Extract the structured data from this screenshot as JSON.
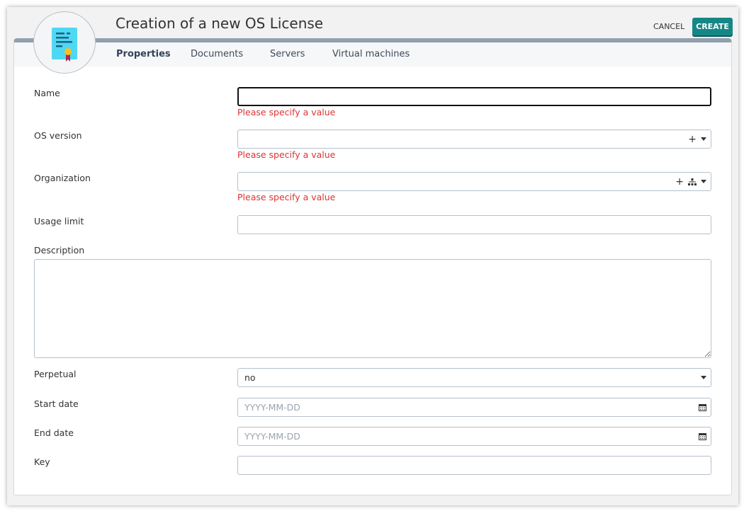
{
  "header": {
    "title": "Creation of a new OS License",
    "cancel_label": "CANCEL",
    "create_label": "CREATE"
  },
  "tabs": [
    {
      "label": "Properties"
    },
    {
      "label": "Documents"
    },
    {
      "label": "Servers"
    },
    {
      "label": "Virtual machines"
    }
  ],
  "form": {
    "name": {
      "label": "Name",
      "value": "",
      "error": "Please specify a value"
    },
    "os_version": {
      "label": "OS version",
      "value": "",
      "error": "Please specify a value"
    },
    "organization": {
      "label": "Organization",
      "value": "",
      "error": "Please specify a value"
    },
    "usage_limit": {
      "label": "Usage limit",
      "value": ""
    },
    "description": {
      "label": "Description",
      "value": ""
    },
    "perpetual": {
      "label": "Perpetual",
      "value": "no"
    },
    "start_date": {
      "label": "Start date",
      "placeholder": "YYYY-MM-DD"
    },
    "end_date": {
      "label": "End date",
      "placeholder": "YYYY-MM-DD"
    },
    "key": {
      "label": "Key",
      "value": ""
    }
  },
  "colors": {
    "accent": "#168787",
    "error": "#dd3333",
    "tab_border": "#929fae"
  }
}
